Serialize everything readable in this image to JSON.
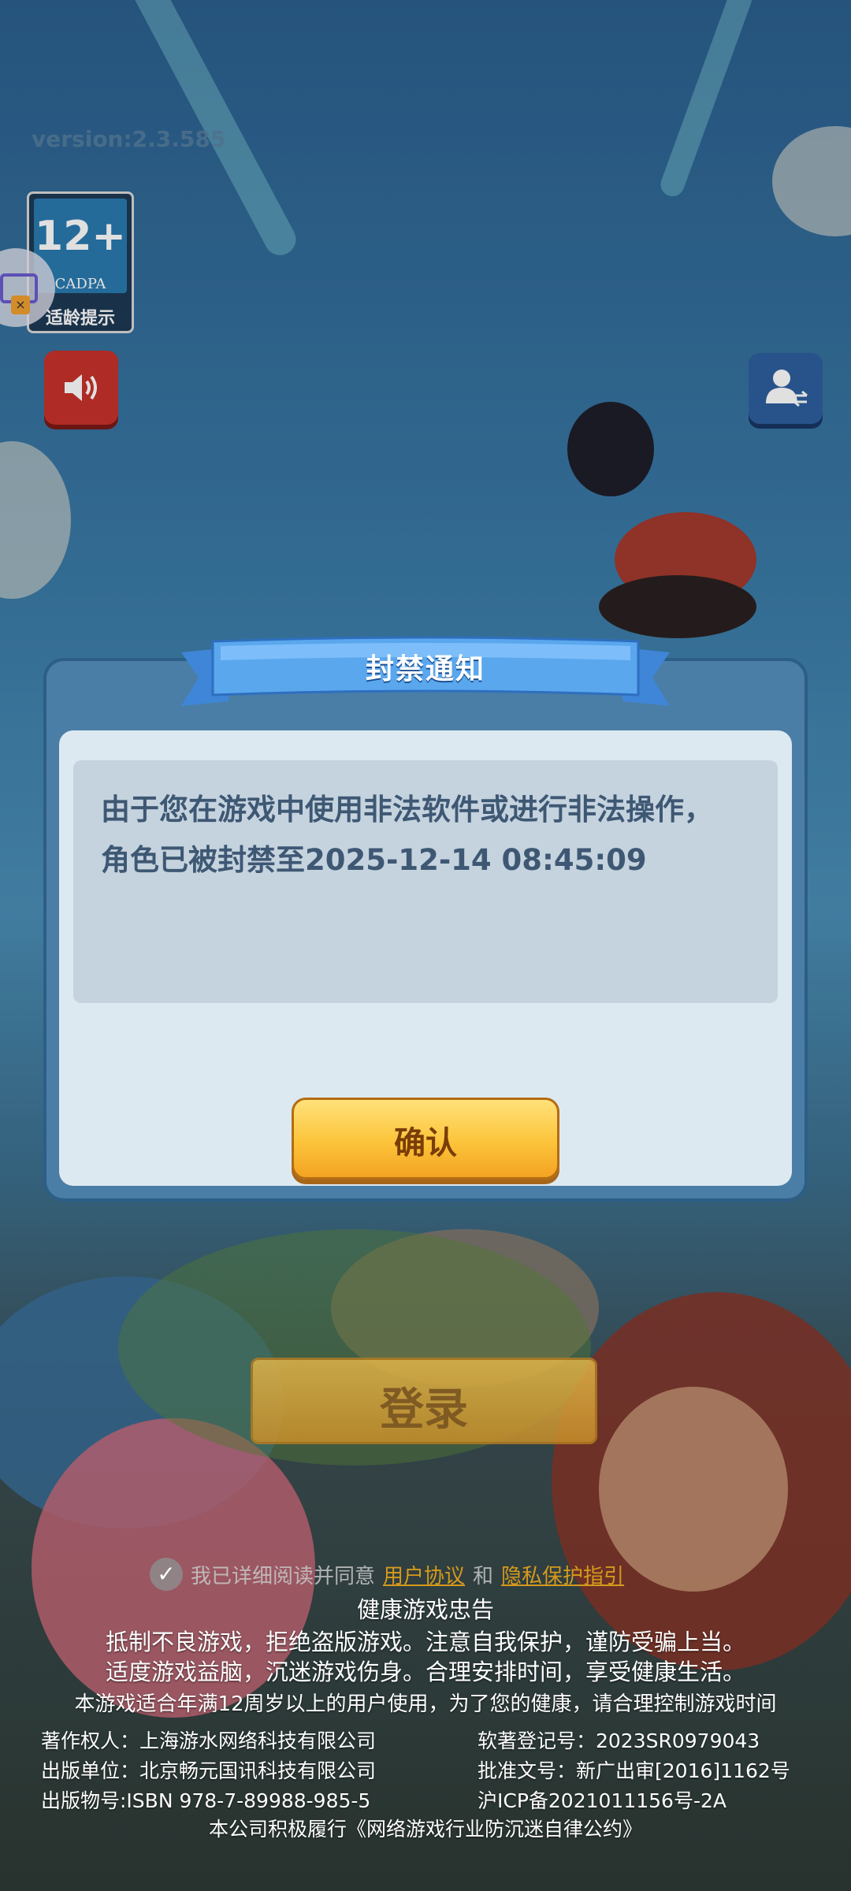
{
  "version": "version:2.3.585",
  "age_badge": {
    "number": "12+",
    "org": "CADPA",
    "tip": "适龄提示"
  },
  "dialog": {
    "title": "封禁通知",
    "message": "由于您在游戏中使用非法软件或进行非法操作，角色已被封禁至2025-12-14 08:45:09",
    "confirm_label": "确认"
  },
  "login_label": "登录",
  "agreement": {
    "prefix": "我已详细阅读并同意",
    "user_agreement": "用户协议",
    "and": "和",
    "privacy_policy": "隐私保护指引"
  },
  "health": {
    "title": "健康游戏忠告",
    "line1": "抵制不良游戏，拒绝盗版游戏。注意自我保护，谨防受骗上当。",
    "line2": "适度游戏益脑，沉迷游戏伤身。合理安排时间，享受健康生活。",
    "age_note": "本游戏适合年满12周岁以上的用户使用，为了您的健康，请合理控制游戏时间"
  },
  "copyright": {
    "owner": "著作权人：上海游水网络科技有限公司",
    "reg_no": "软著登记号：2023SR0979043",
    "publisher": "出版单位：北京畅元国讯科技有限公司",
    "approval": "批准文号：新广出审[2016]1162号",
    "isbn": "出版物号:ISBN 978-7-89988-985-5",
    "icp": "沪ICP备2021011156号-2A",
    "pledge": "本公司积极履行《网络游戏行业防沉迷自律公约》"
  }
}
